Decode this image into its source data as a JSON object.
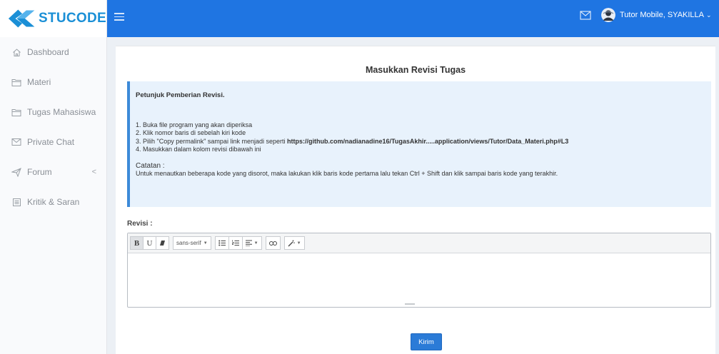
{
  "brand": {
    "name": "STUCODE"
  },
  "sidebar": {
    "items": [
      {
        "label": "Dashboard",
        "icon": "home-icon"
      },
      {
        "label": "Materi",
        "icon": "folder-icon"
      },
      {
        "label": "Tugas Mahasiswa",
        "icon": "folder-icon"
      },
      {
        "label": "Private Chat",
        "icon": "mail-icon"
      },
      {
        "label": "Forum",
        "icon": "send-icon",
        "chevron": "<"
      },
      {
        "label": "Kritik & Saran",
        "icon": "list-icon"
      }
    ]
  },
  "header": {
    "user_name": "Tutor Mobile, SYAKILLA",
    "accent": "#1f75e2"
  },
  "main": {
    "title": "Masukkan Revisi Tugas",
    "instructions": {
      "heading": "Petunjuk Pemberian Revisi.",
      "steps": [
        "1. Buka file program yang akan diperiksa",
        "2. Klik nomor baris di sebelah kiri kode",
        "3. Pilih \"Copy permalink\" sampai link menjadi seperti ",
        "4. Masukkan dalam kolom revisi dibawah ini"
      ],
      "example_link": "https://github.com/nadianadine16/TugasAkhir.....application/views/Tutor/Data_Materi.php#L3",
      "note_heading": "Catatan :",
      "note_body": "Untuk menautkan beberapa kode yang disorot, maka lakukan klik baris kode pertama lalu tekan Ctrl + Shift dan klik sampai baris kode yang terakhir."
    },
    "revisi_label": "Revisi :",
    "toolbar": {
      "bold": "B",
      "underline": "U",
      "eraser": "",
      "font": "sans-serif",
      "ul": "",
      "ol": "",
      "align": "",
      "link": "",
      "magic": ""
    },
    "submit_label": "Kirim",
    "submit_color": "#2b7bd7"
  }
}
